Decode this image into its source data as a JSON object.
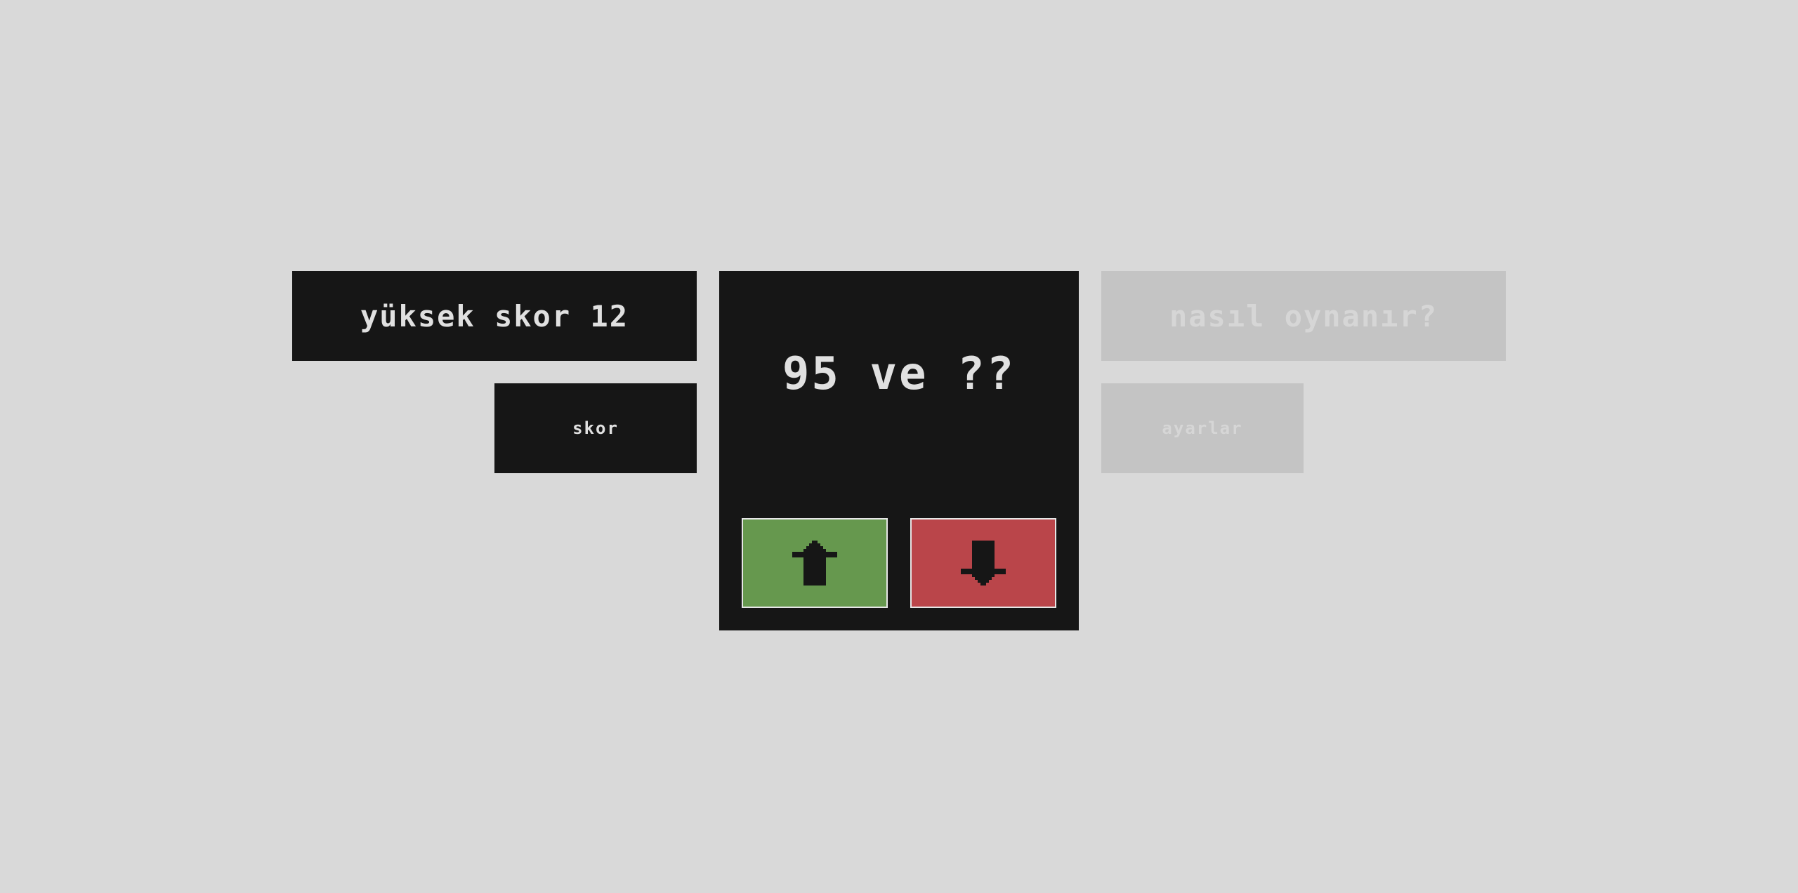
{
  "high_score": {
    "label": "yüksek skor",
    "value": "12",
    "text": "yüksek skor 12"
  },
  "buttons": {
    "score_label": "skor",
    "how_to_play_label": "nasıl oynanır?",
    "settings_label": "ayarlar"
  },
  "game": {
    "question": "95 ve ??",
    "up_icon": "arrow-up-icon",
    "down_icon": "arrow-down-icon"
  },
  "colors": {
    "background": "#d9d9d9",
    "panel_dark": "#161616",
    "panel_muted": "#c4c4c4",
    "up_button": "#66984e",
    "down_button": "#ba454a",
    "text_light": "#e0e0e0"
  }
}
